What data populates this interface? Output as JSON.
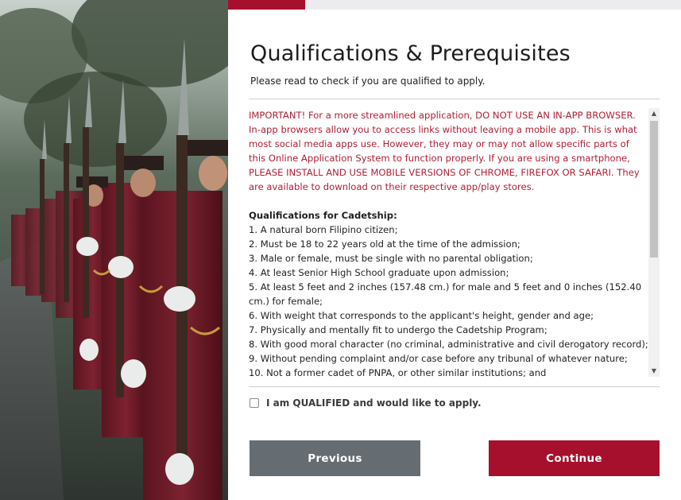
{
  "header": {
    "title": "Qualifications & Prerequisites",
    "subtitle": "Please read to check if you are qualified to apply."
  },
  "progress": {
    "fraction": 0.17,
    "color": "#a6102d"
  },
  "content": {
    "warning": "IMPORTANT! For a more streamlined application, DO NOT USE AN IN-APP BROWSER. In-app browsers allow you to access links without leaving a mobile app. This is what most social media apps use. However, they may or may not allow specific parts of this Online Application System to function properly. If you are using a smartphone, PLEASE INSTALL AND USE MOBILE VERSIONS OF CHROME, FIREFOX OR SAFARI. They are available to download on their respective app/play stores.",
    "qualifications_heading": "Qualifications for Cadetship:",
    "qualifications": [
      "1. A natural born Filipino citizen;",
      "2. Must be 18 to 22 years old at the time of the admission;",
      "3. Male or female, must be single with no parental obligation;",
      "4. At least Senior High School graduate upon admission;",
      "5. At least 5 feet and 2 inches (157.48 cm.) for male and 5 feet and 0 inches (152.40 cm.) for female;",
      "6. With weight that corresponds to the applicant's height, gender and age;",
      "7. Physically and mentally fit to undergo the Cadetship Program;",
      "8. With good moral character (no criminal, administrative and civil derogatory record);",
      "9. Without pending complaint and/or case before any tribunal of whatever nature;",
      "10. Not a former cadet of PNPA, or other similar institutions; and"
    ]
  },
  "agreement": {
    "label": "I am QUALIFIED and would like to apply.",
    "checked": false
  },
  "buttons": {
    "previous": "Previous",
    "continue": "Continue"
  },
  "colors": {
    "accent": "#a6102d",
    "secondary_button": "#666d72",
    "warning_text": "#b02034"
  },
  "icons": {
    "scroll_up": "triangle-up-icon",
    "scroll_down": "triangle-down-icon"
  }
}
